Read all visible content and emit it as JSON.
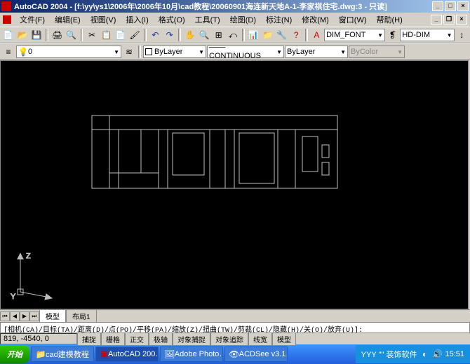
{
  "title": "AutoCAD 2004 - [f:\\yy\\ys1\\2006年\\2006年10月\\cad教程\\20060901海连新天地A-1-李家祺住宅.dwg:3 - 只读]",
  "menus": [
    "文件(F)",
    "编辑(E)",
    "视图(V)",
    "插入(I)",
    "格式(O)",
    "工具(T)",
    "绘图(D)",
    "标注(N)",
    "修改(M)",
    "窗口(W)",
    "帮助(H)"
  ],
  "toolbar1_icons": [
    "new",
    "open",
    "save",
    "print",
    "preview",
    "cut",
    "copy",
    "paste",
    "match",
    "undo",
    "redo",
    "pan",
    "zoom-rt",
    "zoom-win",
    "zoom-prev",
    "props",
    "dc",
    "help"
  ],
  "styles": {
    "dim_style": "DIM_FONT",
    "dim_style2": "HD-DIM"
  },
  "layer_row": {
    "layer": "ByLayer",
    "linetype": "CONTINUOUS",
    "lineweight": "ByLayer",
    "color": "ByColor",
    "plot": "ByLayer"
  },
  "axes": {
    "y": "Y",
    "z": "Z"
  },
  "tabs": {
    "model": "模型",
    "layout1": "布局1"
  },
  "command_line": "[相机(CA)/目标(TA)/距离(D)/点(PO)/平移(PA)/缩放(Z)/扭曲(TW)/剪裁(CL)/隐藏(H)/关(O)/放弃(U)]:",
  "coords": "819, -4540, 0",
  "status_buttons": [
    "捕捉",
    "栅格",
    "正交",
    "极轴",
    "对象捕捉",
    "对象追踪",
    "线宽",
    "模型"
  ],
  "taskbar": {
    "start": "开始",
    "items": [
      "cad建模教程",
      "AutoCAD 200…",
      "Adobe Photo…",
      "ACDSee v3.1…"
    ],
    "tray_text": "YYY \"\" 装饰软件",
    "clock": "15:51"
  }
}
